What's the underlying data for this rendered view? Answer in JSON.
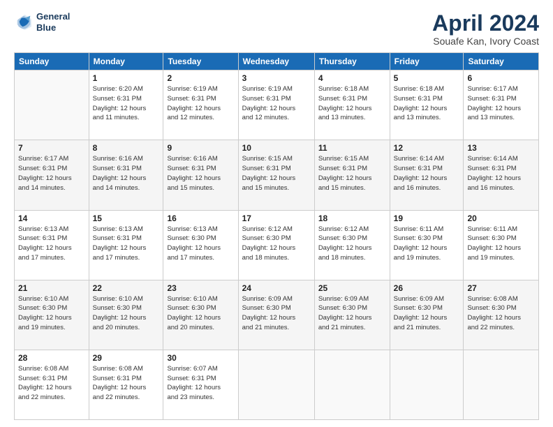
{
  "header": {
    "logo_line1": "General",
    "logo_line2": "Blue",
    "title": "April 2024",
    "subtitle": "Souafe Kan, Ivory Coast"
  },
  "columns": [
    "Sunday",
    "Monday",
    "Tuesday",
    "Wednesday",
    "Thursday",
    "Friday",
    "Saturday"
  ],
  "weeks": [
    [
      {
        "day": "",
        "info": ""
      },
      {
        "day": "1",
        "info": "Sunrise: 6:20 AM\nSunset: 6:31 PM\nDaylight: 12 hours\nand 11 minutes."
      },
      {
        "day": "2",
        "info": "Sunrise: 6:19 AM\nSunset: 6:31 PM\nDaylight: 12 hours\nand 12 minutes."
      },
      {
        "day": "3",
        "info": "Sunrise: 6:19 AM\nSunset: 6:31 PM\nDaylight: 12 hours\nand 12 minutes."
      },
      {
        "day": "4",
        "info": "Sunrise: 6:18 AM\nSunset: 6:31 PM\nDaylight: 12 hours\nand 13 minutes."
      },
      {
        "day": "5",
        "info": "Sunrise: 6:18 AM\nSunset: 6:31 PM\nDaylight: 12 hours\nand 13 minutes."
      },
      {
        "day": "6",
        "info": "Sunrise: 6:17 AM\nSunset: 6:31 PM\nDaylight: 12 hours\nand 13 minutes."
      }
    ],
    [
      {
        "day": "7",
        "info": "Sunrise: 6:17 AM\nSunset: 6:31 PM\nDaylight: 12 hours\nand 14 minutes."
      },
      {
        "day": "8",
        "info": "Sunrise: 6:16 AM\nSunset: 6:31 PM\nDaylight: 12 hours\nand 14 minutes."
      },
      {
        "day": "9",
        "info": "Sunrise: 6:16 AM\nSunset: 6:31 PM\nDaylight: 12 hours\nand 15 minutes."
      },
      {
        "day": "10",
        "info": "Sunrise: 6:15 AM\nSunset: 6:31 PM\nDaylight: 12 hours\nand 15 minutes."
      },
      {
        "day": "11",
        "info": "Sunrise: 6:15 AM\nSunset: 6:31 PM\nDaylight: 12 hours\nand 15 minutes."
      },
      {
        "day": "12",
        "info": "Sunrise: 6:14 AM\nSunset: 6:31 PM\nDaylight: 12 hours\nand 16 minutes."
      },
      {
        "day": "13",
        "info": "Sunrise: 6:14 AM\nSunset: 6:31 PM\nDaylight: 12 hours\nand 16 minutes."
      }
    ],
    [
      {
        "day": "14",
        "info": "Sunrise: 6:13 AM\nSunset: 6:31 PM\nDaylight: 12 hours\nand 17 minutes."
      },
      {
        "day": "15",
        "info": "Sunrise: 6:13 AM\nSunset: 6:31 PM\nDaylight: 12 hours\nand 17 minutes."
      },
      {
        "day": "16",
        "info": "Sunrise: 6:13 AM\nSunset: 6:30 PM\nDaylight: 12 hours\nand 17 minutes."
      },
      {
        "day": "17",
        "info": "Sunrise: 6:12 AM\nSunset: 6:30 PM\nDaylight: 12 hours\nand 18 minutes."
      },
      {
        "day": "18",
        "info": "Sunrise: 6:12 AM\nSunset: 6:30 PM\nDaylight: 12 hours\nand 18 minutes."
      },
      {
        "day": "19",
        "info": "Sunrise: 6:11 AM\nSunset: 6:30 PM\nDaylight: 12 hours\nand 19 minutes."
      },
      {
        "day": "20",
        "info": "Sunrise: 6:11 AM\nSunset: 6:30 PM\nDaylight: 12 hours\nand 19 minutes."
      }
    ],
    [
      {
        "day": "21",
        "info": "Sunrise: 6:10 AM\nSunset: 6:30 PM\nDaylight: 12 hours\nand 19 minutes."
      },
      {
        "day": "22",
        "info": "Sunrise: 6:10 AM\nSunset: 6:30 PM\nDaylight: 12 hours\nand 20 minutes."
      },
      {
        "day": "23",
        "info": "Sunrise: 6:10 AM\nSunset: 6:30 PM\nDaylight: 12 hours\nand 20 minutes."
      },
      {
        "day": "24",
        "info": "Sunrise: 6:09 AM\nSunset: 6:30 PM\nDaylight: 12 hours\nand 21 minutes."
      },
      {
        "day": "25",
        "info": "Sunrise: 6:09 AM\nSunset: 6:30 PM\nDaylight: 12 hours\nand 21 minutes."
      },
      {
        "day": "26",
        "info": "Sunrise: 6:09 AM\nSunset: 6:30 PM\nDaylight: 12 hours\nand 21 minutes."
      },
      {
        "day": "27",
        "info": "Sunrise: 6:08 AM\nSunset: 6:30 PM\nDaylight: 12 hours\nand 22 minutes."
      }
    ],
    [
      {
        "day": "28",
        "info": "Sunrise: 6:08 AM\nSunset: 6:31 PM\nDaylight: 12 hours\nand 22 minutes."
      },
      {
        "day": "29",
        "info": "Sunrise: 6:08 AM\nSunset: 6:31 PM\nDaylight: 12 hours\nand 22 minutes."
      },
      {
        "day": "30",
        "info": "Sunrise: 6:07 AM\nSunset: 6:31 PM\nDaylight: 12 hours\nand 23 minutes."
      },
      {
        "day": "",
        "info": ""
      },
      {
        "day": "",
        "info": ""
      },
      {
        "day": "",
        "info": ""
      },
      {
        "day": "",
        "info": ""
      }
    ]
  ]
}
